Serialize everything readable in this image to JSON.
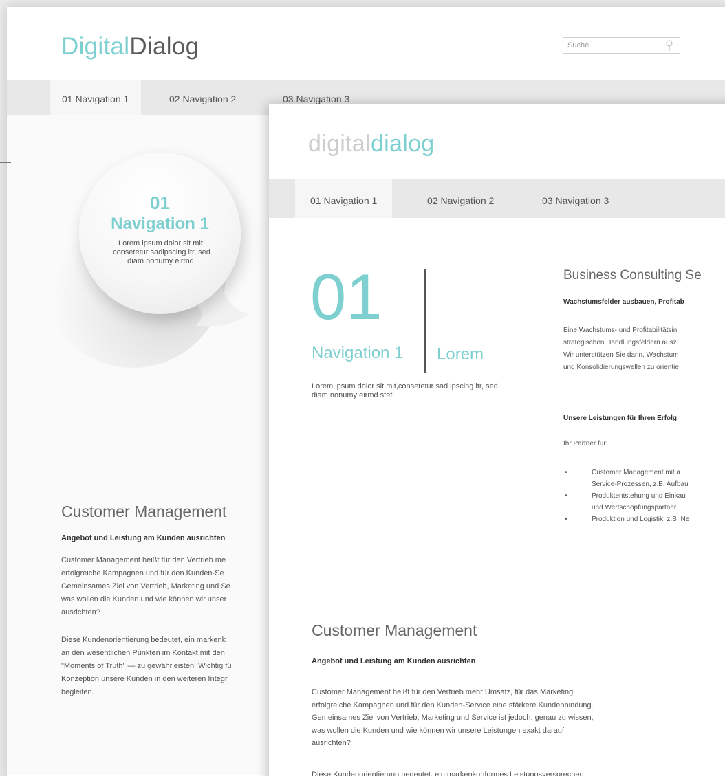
{
  "back": {
    "logo": {
      "part1": "Digital",
      "part2": "Dialog"
    },
    "search": {
      "placeholder": "Suche"
    },
    "nav": [
      "01 Navigation 1",
      "02 Navigation 2",
      "03 Navigation 3"
    ],
    "bubble": {
      "number": "01",
      "title": "Navigation 1",
      "text": "Lorem ipsum dolor sit mit, consetetur sadipscing ltr, sed diam nonumy eirmd."
    },
    "section": {
      "title": "Customer Management",
      "subtitle": "Angebot und Leistung am Kunden ausrichten",
      "p1": [
        "Customer Management heißt für den Vertrieb me",
        "erfolgreiche Kampagnen und für den Kunden-Se",
        "Gemeinsames Ziel von Vertrieb, Marketing und Se",
        "was wollen die Kunden und wie können wir unser",
        "ausrichten?"
      ],
      "p2": [
        "Diese Kundenorientierung bedeutet, ein markenk",
        "an den wesentlichen Punkten im Kontakt mit den",
        "\"Moments of Truth\" — zu gewährleisten. Wichtig fü",
        "Konzeption unsere Kunden in den weiteren Integr",
        "begleiten."
      ]
    }
  },
  "front": {
    "logo": {
      "part1": "digital",
      "part2": "dialog"
    },
    "nav": [
      "01 Navigation 1",
      "02 Navigation 2",
      "03 Navigation 3"
    ],
    "hero": {
      "number": "01",
      "title": "Navigation 1",
      "lorem": "Lorem",
      "intro": "Lorem ipsum dolor sit mit,consetetur sad ipscing ltr, sed diam nonumy eirmd stet."
    },
    "business": {
      "title": "Business Consulting Se",
      "subtitle": "Wachstumsfelder ausbauen, Profitab",
      "paragraph": [
        "Eine Wachstums- und Profitabilitätsin",
        "strategischen Handlungsfeldern ausz",
        "Wir unterstützen Sie darin, Wachstum",
        "und Konsolidierungswellen zu orientie"
      ],
      "heading": "Unsere Leistungen für Ihren Erfolg",
      "partner": "Ihr Partner für:",
      "list": [
        [
          "Customer Management mit a",
          "Service-Prozessen, z.B. Aufbau"
        ],
        [
          "Produktentstehung und Einkau",
          "und Wertschöpfungspartner"
        ],
        [
          "Produktion und Logistik, z.B. Ne"
        ]
      ]
    },
    "section": {
      "title": "Customer Management",
      "subtitle": "Angebot und Leistung am Kunden ausrichten",
      "p1": [
        "Customer Management heißt für den Vertrieb mehr Umsatz, für das Marketing",
        "erfolgreiche Kampagnen und für den Kunden-Service eine stärkere Kundenbindung.",
        "Gemeinsames Ziel von Vertrieb, Marketing und Service ist jedoch: genau zu wissen,",
        "was wollen die Kunden und wie können wir unsere Leistungen exakt darauf",
        "ausrichten?"
      ],
      "p2": [
        "Diese Kundenorientierung bedeutet, ein markenkonformes Leistungsversprechen"
      ]
    }
  }
}
